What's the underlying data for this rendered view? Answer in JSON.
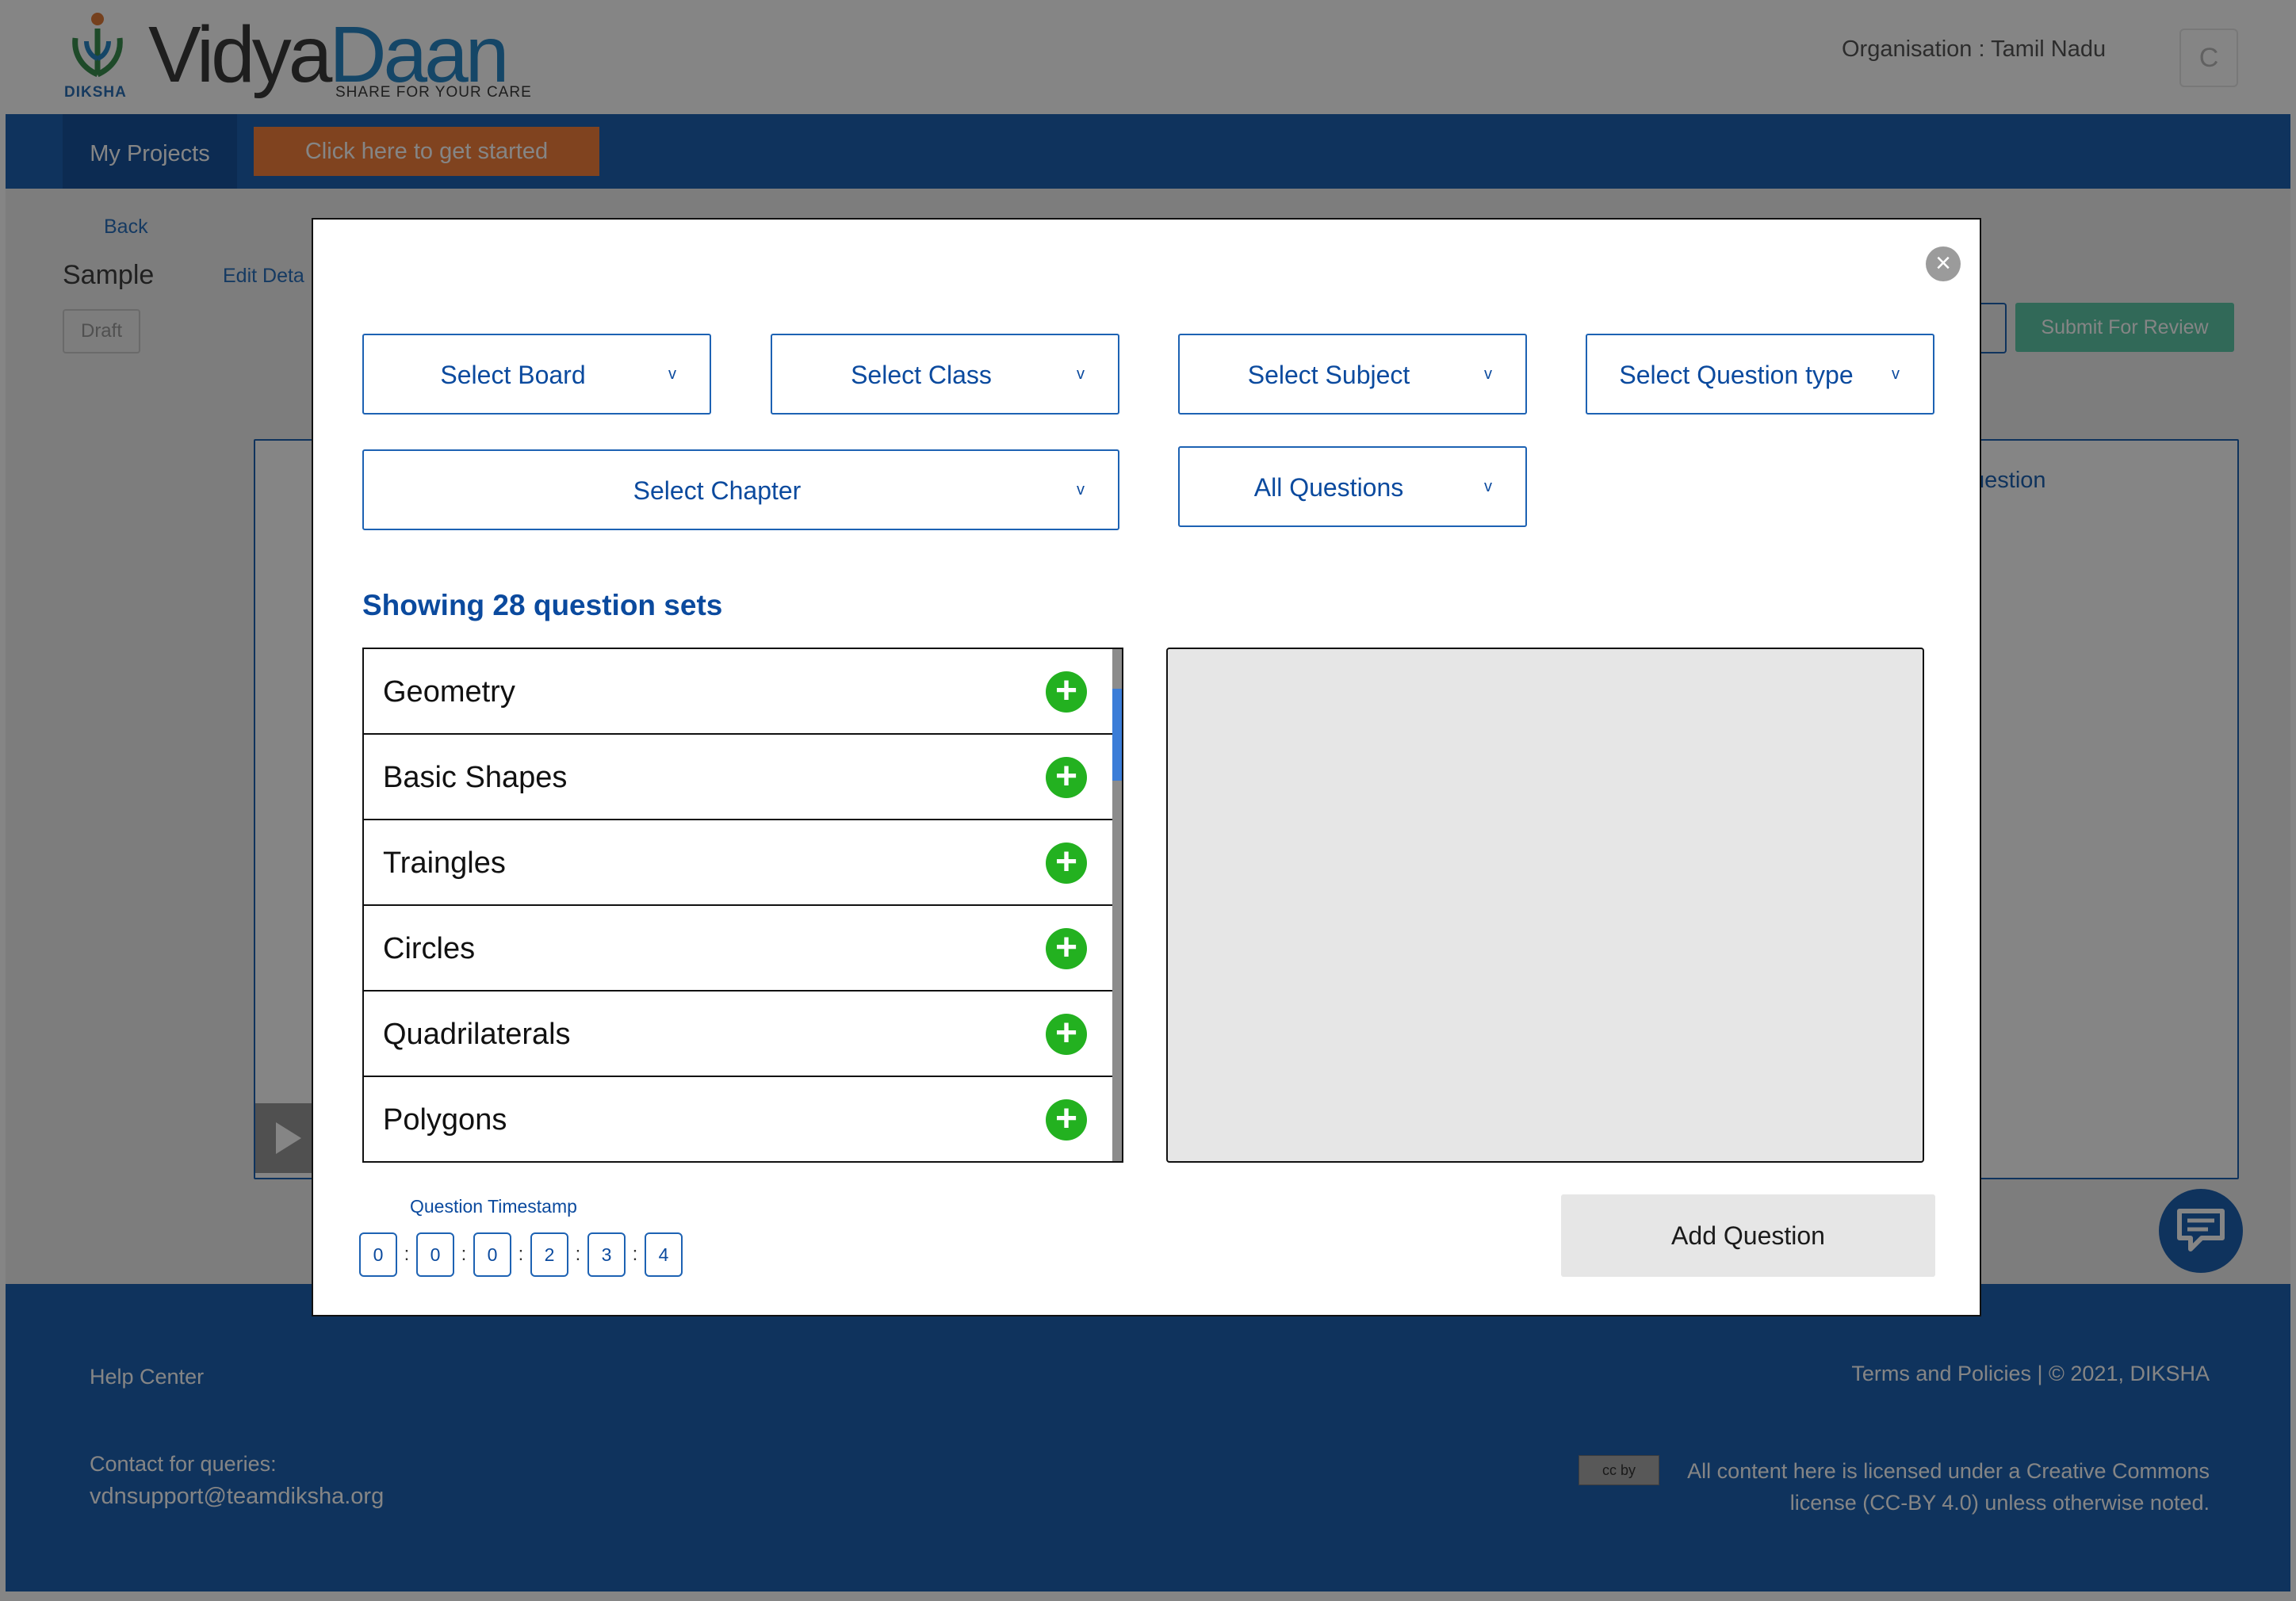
{
  "header": {
    "logo": {
      "diksha": "DIKSHA",
      "vidya": "Vidya",
      "daan": "Daan",
      "tagline": "SHARE FOR YOUR CARE"
    },
    "organisation": "Organisation : Tamil Nadu",
    "avatar_initial": "C"
  },
  "nav": {
    "my_projects": "My Projects",
    "cta": "Click here to get started"
  },
  "project": {
    "back": "Back",
    "title": "Sample",
    "edit_details": "Edit Deta",
    "status": "Draft",
    "submit": "Submit For Review",
    "add_question_partial": "uestion"
  },
  "footer": {
    "help": "Help Center",
    "contact_label": "Contact for queries:",
    "contact_email": "vdnsupport@teamdiksha.org",
    "terms": "Terms and Policies  | © 2021, DIKSHA",
    "cc_badge": "cc by",
    "license": "All content here is licensed under a Creative Commons license (CC-BY 4.0) unless otherwise noted."
  },
  "modal": {
    "filters": {
      "board": "Select Board",
      "class": "Select Class",
      "subject": "Select Subject",
      "question_type": "Select Question type",
      "chapter": "Select Chapter",
      "questions": "All Questions"
    },
    "showing": "Showing 28 question sets",
    "question_sets": [
      "Geometry",
      "Basic Shapes",
      "Traingles",
      "Circles",
      "Quadrilaterals",
      "Polygons"
    ],
    "timestamp": {
      "label": "Question Timestamp",
      "digits": [
        "0",
        "0",
        "0",
        "2",
        "3",
        "4"
      ]
    },
    "add_question": "Add Question"
  },
  "colors": {
    "primary": "#1d62b3",
    "text_blue": "#0b4a9e",
    "add_green": "#23b120",
    "cta_orange": "#f6813d",
    "submit_green": "#5ec9a9"
  }
}
